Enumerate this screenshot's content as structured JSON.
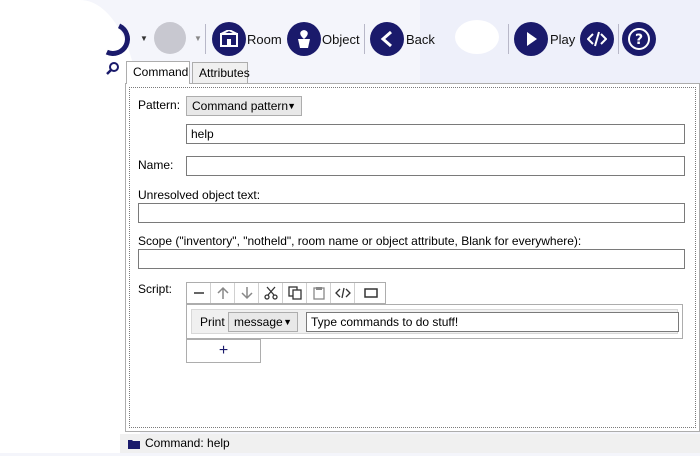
{
  "toolbar": {
    "room_label": "Room",
    "object_label": "Object",
    "back_label": "Back",
    "play_label": "Play"
  },
  "tabs": {
    "command": "Command",
    "attributes": "Attributes"
  },
  "form": {
    "pattern_label": "Pattern:",
    "pattern_type": "Command pattern",
    "pattern_value": "help",
    "name_label": "Name:",
    "name_value": "",
    "unresolved_label": "Unresolved object text:",
    "unresolved_value": "",
    "scope_label": "Scope (\"inventory\", \"notheld\", room name or object attribute, Blank for everywhere):",
    "scope_value": "",
    "script_label": "Script:"
  },
  "script": {
    "line_keyword": "Print",
    "line_type": "message",
    "line_text": "Type commands to do stuff!",
    "add_symbol": "+"
  },
  "status": {
    "text": "Command: help"
  },
  "colors": {
    "accent": "#1a1a6b"
  }
}
